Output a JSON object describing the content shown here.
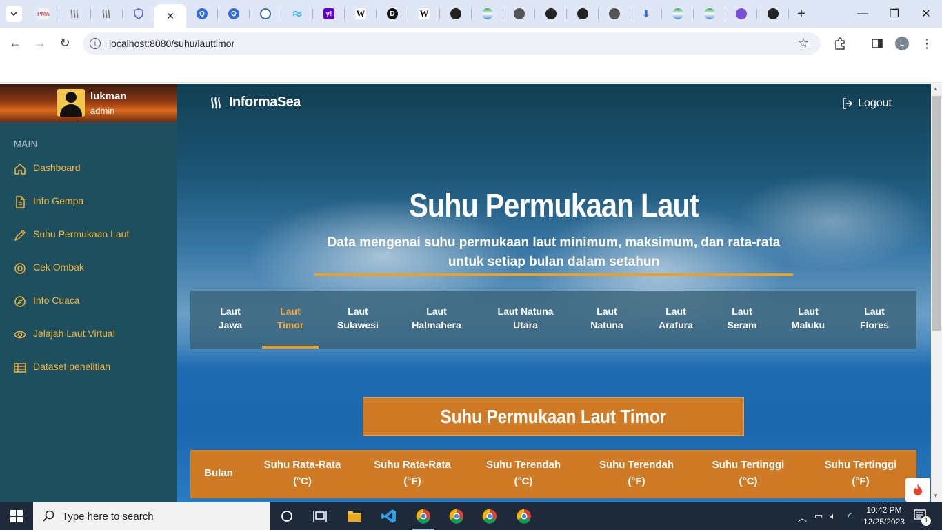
{
  "browser": {
    "tabs": [
      {
        "icon": "pma-icon",
        "active": false
      },
      {
        "icon": "informasea-icon",
        "active": false
      },
      {
        "icon": "informasea-icon",
        "active": false
      },
      {
        "icon": "shield-icon",
        "active": false
      },
      {
        "icon": "close-icon",
        "active": true
      },
      {
        "icon": "q-icon",
        "active": false
      },
      {
        "icon": "q-icon",
        "active": false
      },
      {
        "icon": "circle-icon",
        "active": false
      },
      {
        "icon": "tailwind-icon",
        "active": false
      },
      {
        "icon": "yahoo-icon",
        "active": false
      },
      {
        "icon": "wikipedia-icon",
        "active": false
      },
      {
        "icon": "d-icon",
        "active": false
      },
      {
        "icon": "wikipedia-icon",
        "active": false
      },
      {
        "icon": "github-icon",
        "active": false
      },
      {
        "icon": "bmkg-icon",
        "active": false
      },
      {
        "icon": "globe-icon",
        "active": false
      },
      {
        "icon": "github-icon",
        "active": false
      },
      {
        "icon": "github-icon",
        "active": false
      },
      {
        "icon": "globe-icon",
        "active": false
      },
      {
        "icon": "download-icon",
        "active": false
      },
      {
        "icon": "bmkg-icon",
        "active": false
      },
      {
        "icon": "bmkg-icon",
        "active": false
      },
      {
        "icon": "purple-circle-icon",
        "active": false
      },
      {
        "icon": "github-icon",
        "active": false
      }
    ],
    "url": "localhost:8080/suhu/lauttimor",
    "profile_initial": "L",
    "favicon_letters": {
      "yahoo": "y!",
      "wiki": "W",
      "d": "D"
    }
  },
  "sidebar": {
    "user_name": "lukman",
    "user_role": "admin",
    "section": "MAIN",
    "items": [
      {
        "label": "Dashboard",
        "icon": "home-icon"
      },
      {
        "label": "Info Gempa",
        "icon": "document-icon"
      },
      {
        "label": "Suhu Permukaan Laut",
        "icon": "pen-icon"
      },
      {
        "label": "Cek Ombak",
        "icon": "target-icon"
      },
      {
        "label": "Info Cuaca",
        "icon": "compass-icon"
      },
      {
        "label": "Jelajah Laut Virtual",
        "icon": "eye-icon"
      },
      {
        "label": "Dataset penelitian",
        "icon": "table-icon"
      }
    ]
  },
  "header": {
    "brand": "InformaSea",
    "logout": "Logout"
  },
  "hero": {
    "title": "Suhu Permukaan Laut",
    "subtitle_line1": "Data mengenai suhu permukaan laut minimum, maksimum, dan rata-rata",
    "subtitle_line2": "untuk setiap bulan dalam setahun"
  },
  "sea_tabs": [
    {
      "line1": "Laut",
      "line2": "Jawa",
      "active": false
    },
    {
      "line1": "Laut",
      "line2": "Timor",
      "active": true
    },
    {
      "line1": "Laut",
      "line2": "Sulawesi",
      "active": false
    },
    {
      "line1": "Laut",
      "line2": "Halmahera",
      "active": false
    },
    {
      "line1": "Laut Natuna",
      "line2": "Utara",
      "active": false
    },
    {
      "line1": "Laut",
      "line2": "Natuna",
      "active": false
    },
    {
      "line1": "Laut",
      "line2": "Arafura",
      "active": false
    },
    {
      "line1": "Laut",
      "line2": "Seram",
      "active": false
    },
    {
      "line1": "Laut",
      "line2": "Maluku",
      "active": false
    },
    {
      "line1": "Laut",
      "line2": "Flores",
      "active": false
    }
  ],
  "section_title": "Suhu Permukaan Laut Timor",
  "table": {
    "headers": [
      {
        "line1": "Bulan",
        "line2": ""
      },
      {
        "line1": "Suhu Rata-Rata",
        "line2": "(°C)"
      },
      {
        "line1": "Suhu Rata-Rata",
        "line2": "(°F)"
      },
      {
        "line1": "Suhu Terendah",
        "line2": "(°C)"
      },
      {
        "line1": "Suhu Terendah",
        "line2": "(°F)"
      },
      {
        "line1": "Suhu Tertinggi",
        "line2": "(°C)"
      },
      {
        "line1": "Suhu Tertinggi",
        "line2": "(°F)"
      }
    ]
  },
  "taskbar": {
    "search_placeholder": "Type here to search",
    "time": "10:42 PM",
    "date": "12/25/2023",
    "notification_count": "1"
  },
  "colors": {
    "sidebar_bg": "#1d4f5f",
    "accent": "#f3b43a",
    "orange": "#cf7b26"
  }
}
